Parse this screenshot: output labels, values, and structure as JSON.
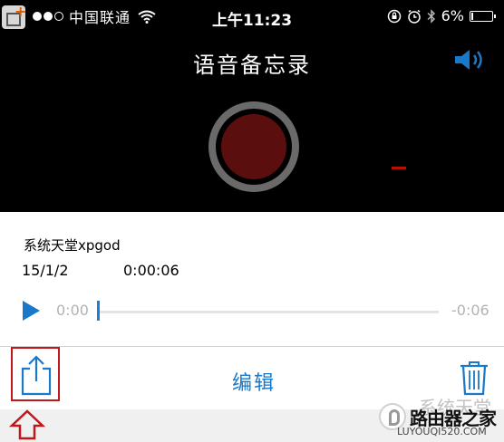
{
  "status_bar": {
    "carrier": "中国联通",
    "time": "上午11:23",
    "battery": "6%",
    "battery_level_percent": 6
  },
  "header": {
    "title": "语音备忘录"
  },
  "recording": {
    "name": "系统天堂xpgod",
    "date": "15/1/2",
    "duration": "0:00:06"
  },
  "playback": {
    "current_time": "0:00",
    "remaining_time": "-0:06"
  },
  "toolbar": {
    "edit_label": "编辑"
  },
  "watermark": {
    "text": "系统天堂",
    "brand": "路由器之家",
    "site": "LUYOUQI520.COM"
  },
  "colors": {
    "accent": "#1a78c8",
    "record_button": "#5a0e0e",
    "highlight_box": "#c0181a"
  }
}
